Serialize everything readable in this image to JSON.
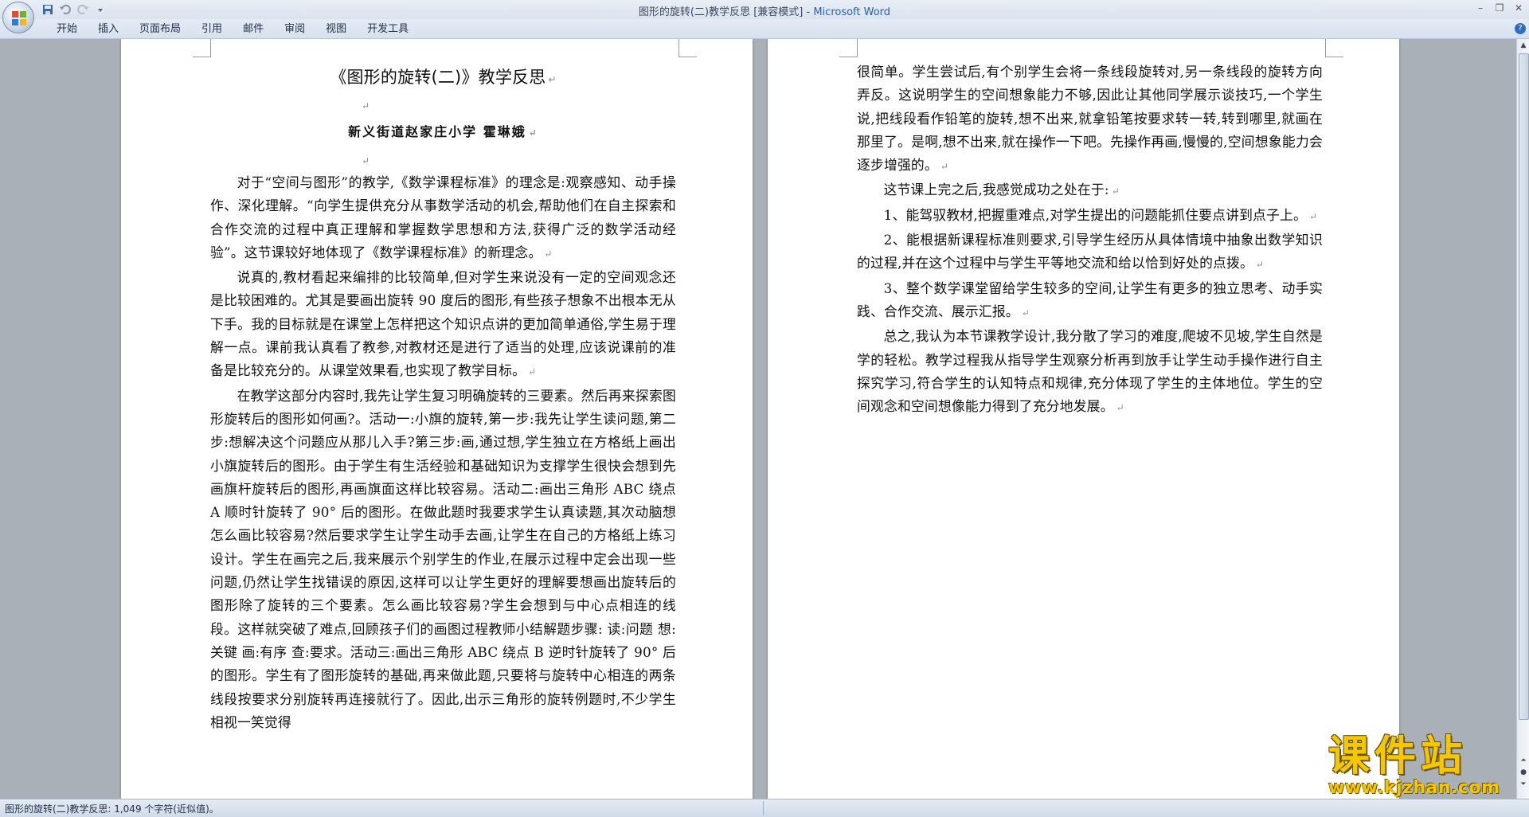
{
  "window": {
    "doc_name": "图形的旋转(二)教学反思",
    "mode": "[兼容模式]",
    "separator": " - ",
    "app_name": "Microsoft Word"
  },
  "ribbon": {
    "tabs": [
      "开始",
      "插入",
      "页面布局",
      "引用",
      "邮件",
      "审阅",
      "视图",
      "开发工具"
    ]
  },
  "document": {
    "title": "《图形的旋转(二)》教学反思",
    "author": "新义街道赵家庄小学    霍琳娥",
    "left_paragraphs": [
      "对于“空间与图形”的教学,《数学课程标准》的理念是:观察感知、动手操作、深化理解。“向学生提供充分从事数学活动的机会,帮助他们在自主探索和合作交流的过程中真正理解和掌握数学思想和方法,获得广泛的数学活动经验”。这节课较好地体现了《数学课程标准》的新理念。",
      "说真的,教材看起来编排的比较简单,但对学生来说没有一定的空间观念还是比较困难的。尤其是要画出旋转 90 度后的图形,有些孩子想象不出根本无从下手。我的目标就是在课堂上怎样把这个知识点讲的更加简单通俗,学生易于理解一点。课前我认真看了教参,对教材还是进行了适当的处理,应该说课前的准备是比较充分的。从课堂效果看,也实现了教学目标。",
      "在教学这部分内容时,我先让学生复习明确旋转的三要素。然后再来探索图形旋转后的图形如何画?。活动一:小旗的旋转,第一步:我先让学生读问题,第二步:想解决这个问题应从那儿入手?第三步:画,通过想,学生独立在方格纸上画出小旗旋转后的图形。由于学生有生活经验和基础知识为支撑学生很快会想到先画旗杆旋转后的图形,再画旗面这样比较容易。活动二:画出三角形 ABC 绕点 A 顺时针旋转了 90° 后的图形。在做此题时我要求学生认真读题,其次动脑想怎么画比较容易?然后要求学生让学生动手去画,让学生在自己的方格纸上练习设计。学生在画完之后,我来展示个别学生的作业,在展示过程中定会出现一些问题,仍然让学生找错误的原因,这样可以让学生更好的理解要想画出旋转后的图形除了旋转的三个要素。怎么画比较容易?学生会想到与中心点相连的线段。这样就突破了难点,回顾孩子们的画图过程教师小结解题步骤: 读:问题 想:关键 画:有序 查:要求。活动三:画出三角形 ABC 绕点 B 逆时针旋转了 90° 后的图形。学生有了图形旋转的基础,再来做此题,只要将与旋转中心相连的两条线段按要求分别旋转再连接就行了。因此,出示三角形的旋转例题时,不少学生相视一笑觉得"
    ],
    "right_paragraphs": [
      "很简单。学生尝试后,有个别学生会将一条线段旋转对,另一条线段的旋转方向弄反。这说明学生的空间想象能力不够,因此让其他同学展示谈技巧,一个学生说,把线段看作铅笔的旋转,想不出来,就拿铅笔按要求转一转,转到哪里,就画在那里了。是啊,想不出来,就在操作一下吧。先操作再画,慢慢的,空间想象能力会逐步增强的。",
      "这节课上完之后,我感觉成功之处在于:",
      "1、能驾驭教材,把握重难点,对学生提出的问题能抓住要点讲到点子上。",
      "2、能根据新课程标准则要求,引导学生经历从具体情境中抽象出数学知识的过程,并在这个过程中与学生平等地交流和给以恰到好处的点拨。",
      "3、整个数学课堂留给学生较多的空间,让学生有更多的独立思考、动手实践、合作交流、展示汇报。",
      "总之,我认为本节课教学设计,我分散了学习的难度,爬坡不见坡,学生自然是学的轻松。教学过程我从指导学生观察分析再到放手让学生动手操作进行自主探究学习,符合学生的认知特点和规律,充分体现了学生的主体地位。学生的空间观念和空间想像能力得到了充分地发展。"
    ]
  },
  "status": {
    "text": "图形的旋转(二)教学反思: 1,049 个字符(近似值)。"
  },
  "watermark": {
    "big": "课件站",
    "url": "www.kjzhan.com"
  },
  "colors": {
    "accent": "#2b5fa8",
    "watermark": "#f3c800"
  }
}
